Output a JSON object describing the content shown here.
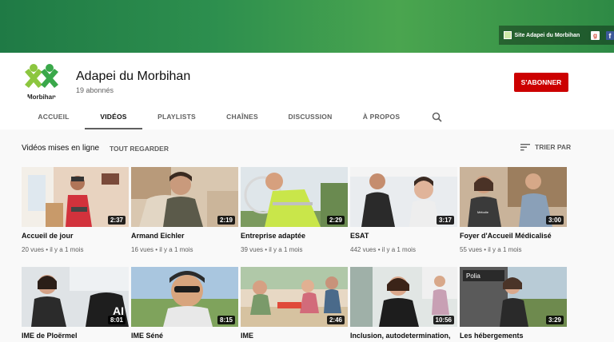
{
  "banner": {
    "link_label": "Site Adapei du Morbihan"
  },
  "channel": {
    "name": "Adapei du Morbihan",
    "subscribers": "19 abonnés",
    "avatar_text": "Morbihan",
    "subscribe_label": "S'ABONNER"
  },
  "tabs": [
    {
      "label": "ACCUEIL"
    },
    {
      "label": "VIDÉOS"
    },
    {
      "label": "PLAYLISTS"
    },
    {
      "label": "CHAÎNES"
    },
    {
      "label": "DISCUSSION"
    },
    {
      "label": "À PROPOS"
    }
  ],
  "section": {
    "title": "Vidéos mises en ligne",
    "play_all": "TOUT REGARDER",
    "sort_label": "TRIER PAR"
  },
  "videos": [
    {
      "title": "Accueil de jour",
      "duration": "2:37",
      "meta": "20 vues • il y a 1 mois"
    },
    {
      "title": "Armand Eichler",
      "duration": "2:19",
      "meta": "16 vues • il y a 1 mois"
    },
    {
      "title": "Entreprise adaptée",
      "duration": "2:29",
      "meta": "39 vues • il y a 1 mois"
    },
    {
      "title": "ESAT",
      "duration": "3:17",
      "meta": "442 vues • il y a 1 mois"
    },
    {
      "title": "Foyer d'Accueil Médicalisé",
      "duration": "3:00",
      "meta": "55 vues • il y a 1 mois"
    },
    {
      "title": "IME de Ploërmel",
      "duration": "8:01",
      "meta": ""
    },
    {
      "title": "IME Séné",
      "duration": "8:15",
      "meta": ""
    },
    {
      "title": "IME",
      "duration": "2:46",
      "meta": ""
    },
    {
      "title": "Inclusion, autodetermination,",
      "duration": "10:56",
      "meta": ""
    },
    {
      "title": "Les hébergements",
      "duration": "3:29",
      "meta": ""
    }
  ],
  "thumb_text": {
    "video_4_caption": "Mélodie",
    "video_10_sign": "Polia"
  },
  "colors": {
    "subscribe": "#cc0000",
    "banner": "#2d8f4e",
    "logo_green": "#8cc63f"
  }
}
